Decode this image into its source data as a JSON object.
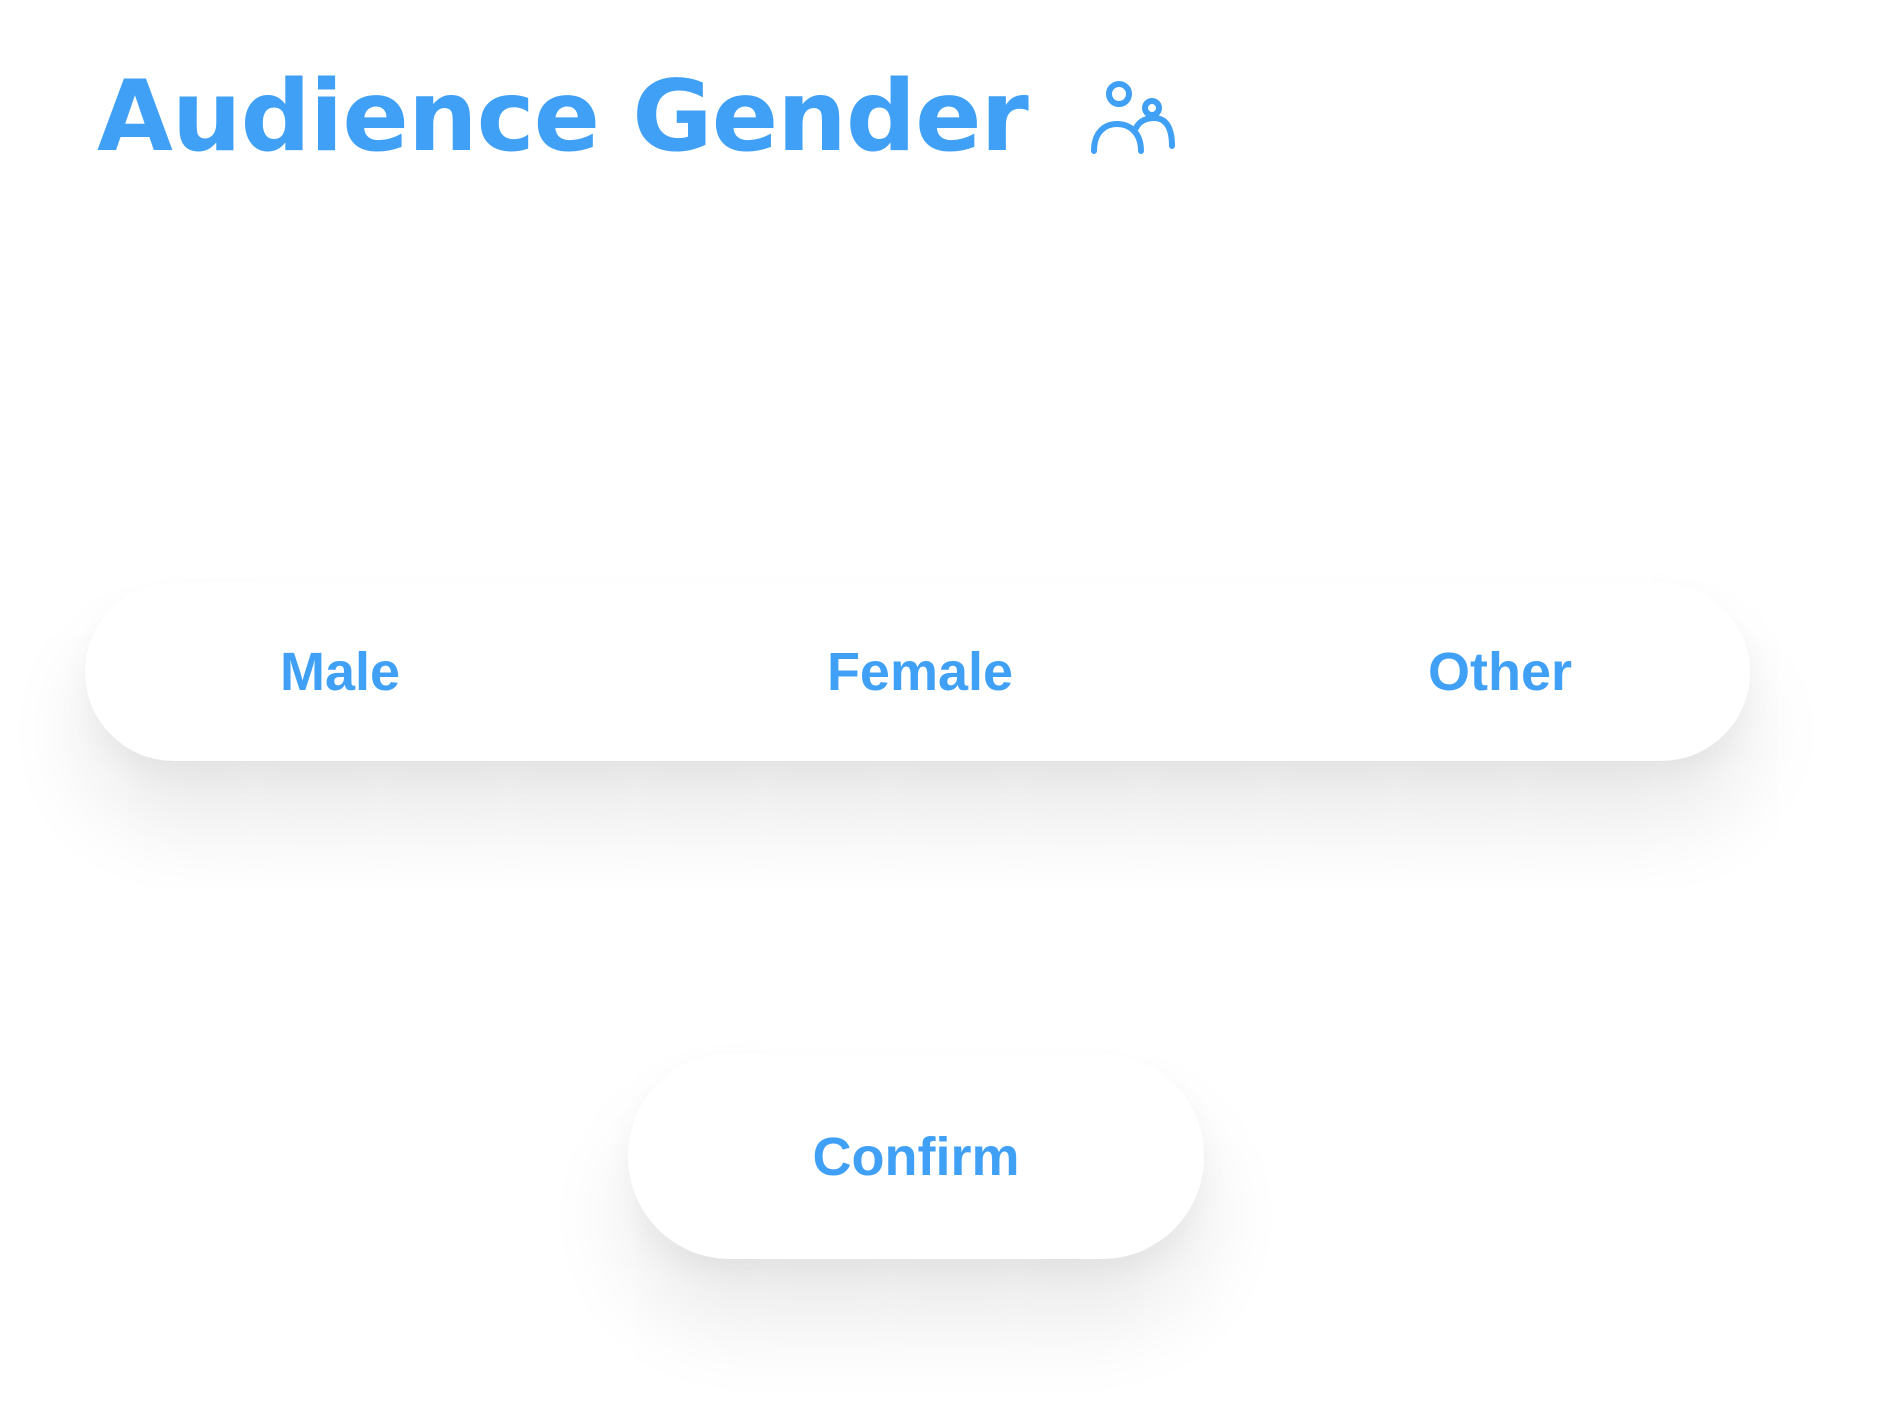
{
  "header": {
    "title": "Audience Gender",
    "icon": "users-icon"
  },
  "gender_options": [
    {
      "label": "Male"
    },
    {
      "label": "Female"
    },
    {
      "label": "Other"
    }
  ],
  "confirm": {
    "label": "Confirm"
  },
  "colors": {
    "accent": "#3fa0f5",
    "background": "#ffffff"
  }
}
